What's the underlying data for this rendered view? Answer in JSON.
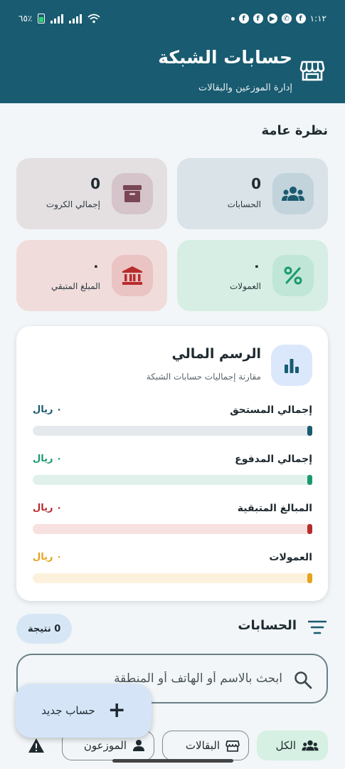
{
  "status_bar": {
    "time": "١:١٢",
    "battery": "٦٥٪"
  },
  "header": {
    "title": "حسابات الشبكة",
    "subtitle": "إدارة الموزعين والبقالات",
    "icon": "store-icon"
  },
  "overview": {
    "title": "نظرة عامة",
    "cards": [
      {
        "value": "0",
        "label": "الحسابات",
        "icon": "people-icon"
      },
      {
        "value": "0",
        "label": "إجمالي الكروت",
        "icon": "archive-box-icon"
      },
      {
        "value": "٠",
        "label": "العمولات",
        "icon": "percent-icon"
      },
      {
        "value": "٠",
        "label": "المبلغ المتبقي",
        "icon": "bank-icon"
      }
    ]
  },
  "finance": {
    "title": "الرسم المالي",
    "subtitle": "مقارنة إجماليات حسابات الشبكة",
    "icon": "bar-chart-icon",
    "rows": [
      {
        "label": "إجمالي المستحق",
        "value": "٠ ريال",
        "color": "#195b70"
      },
      {
        "label": "إجمالي المدفوع",
        "value": "٠ ريال",
        "color": "#1a9a6c"
      },
      {
        "label": "المبالغ المتبقية",
        "value": "٠ ريال",
        "color": "#b72c2c"
      },
      {
        "label": "العمولات",
        "value": "٠ ريال",
        "color": "#e6a31c"
      }
    ]
  },
  "accounts": {
    "title": "الحسابات",
    "result_count": "0 نتيجة",
    "search_placeholder": "ابحث بالاسم أو الهاتف أو المنطقة",
    "filters": [
      {
        "label": "الكل",
        "icon": "people-icon",
        "selected": true
      },
      {
        "label": "البقالات",
        "icon": "store-icon",
        "selected": false
      },
      {
        "label": "الموزعون",
        "icon": "person-icon",
        "selected": false
      },
      {
        "label": "",
        "icon": "warning-icon",
        "selected": false
      }
    ]
  },
  "fab": {
    "label": "حساب جديد",
    "icon": "plus-icon"
  },
  "colors": {
    "primary": "#195b70",
    "success": "#1a9a6c",
    "danger": "#b72c2c",
    "warning": "#e6a31c"
  }
}
